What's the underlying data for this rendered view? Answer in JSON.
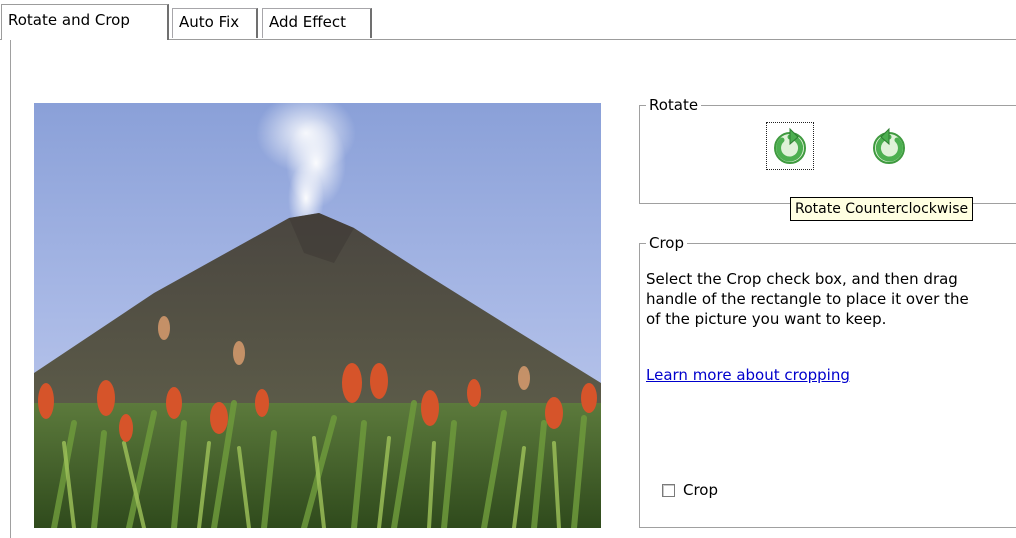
{
  "tabs": [
    {
      "label": "Rotate and Crop",
      "active": true
    },
    {
      "label": "Auto Fix",
      "active": false
    },
    {
      "label": "Add Effect",
      "active": false
    }
  ],
  "rotate": {
    "legend": "Rotate",
    "ccw_icon": "rotate-counterclockwise-icon",
    "cw_icon": "rotate-clockwise-icon",
    "tooltip": "Rotate Counterclockwise"
  },
  "crop": {
    "legend": "Crop",
    "instructions": "Select the Crop check box, and then drag\nhandle of the rectangle to place it over the\nof the picture you want to keep.",
    "learn_more": "Learn more about cropping",
    "checkbox_label": "Crop",
    "checked": false
  },
  "colors": {
    "rotate_icon": "#5cb85c",
    "link": "#0000cc",
    "tooltip_bg": "#ffffe1"
  }
}
